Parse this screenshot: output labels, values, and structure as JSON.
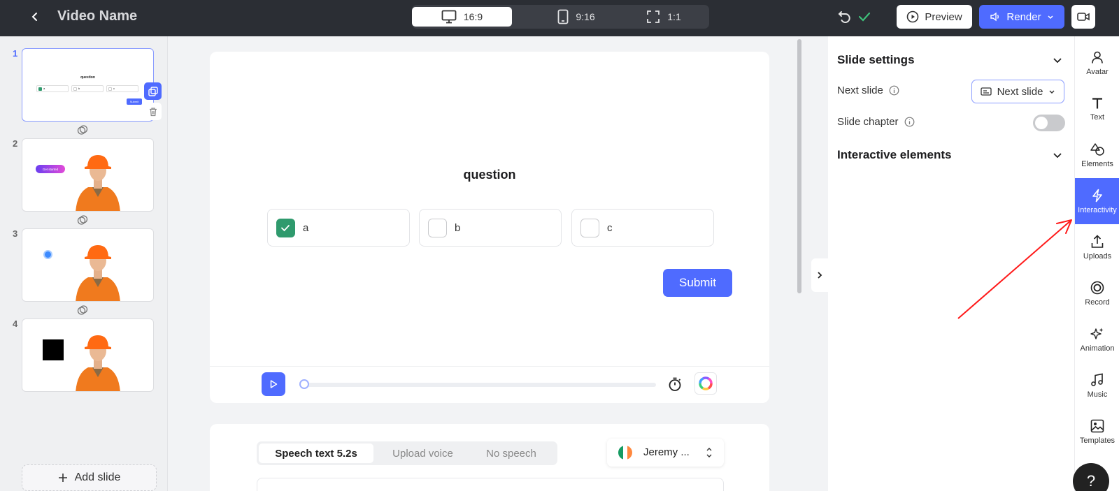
{
  "header": {
    "title": "Video Name",
    "ratios": [
      {
        "label": "16:9",
        "active": true
      },
      {
        "label": "9:16",
        "active": false
      },
      {
        "label": "1:1",
        "active": false
      }
    ],
    "preview_label": "Preview",
    "render_label": "Render"
  },
  "slides": {
    "items": [
      {
        "number": "1",
        "active": true,
        "thumb_title": "question",
        "thumb_submit": "Submit",
        "thumb_options": [
          "a",
          "b",
          "c"
        ]
      },
      {
        "number": "2",
        "active": false,
        "badge": "Get started"
      },
      {
        "number": "3",
        "active": false
      },
      {
        "number": "4",
        "active": false
      }
    ],
    "add_label": "Add slide"
  },
  "canvas": {
    "question": "question",
    "options": [
      {
        "label": "a",
        "checked": true
      },
      {
        "label": "b",
        "checked": false
      },
      {
        "label": "c",
        "checked": false
      }
    ],
    "submit_label": "Submit",
    "progress": 0
  },
  "speech": {
    "tabs": [
      {
        "label": "Speech text 5.2s",
        "active": true
      },
      {
        "label": "Upload voice",
        "active": false
      },
      {
        "label": "No speech",
        "active": false
      }
    ],
    "voice_name": "Jeremy ..."
  },
  "settings": {
    "slide_settings_title": "Slide settings",
    "next_slide_label": "Next slide",
    "next_slide_value": "Next slide",
    "slide_chapter_label": "Slide chapter",
    "slide_chapter_on": false,
    "interactive_title": "Interactive elements"
  },
  "toolbar": {
    "items": [
      {
        "label": "Avatar",
        "icon": "person-icon"
      },
      {
        "label": "Text",
        "icon": "text-icon"
      },
      {
        "label": "Elements",
        "icon": "shapes-icon"
      },
      {
        "label": "Interactivity",
        "icon": "lightning-icon",
        "active": true
      },
      {
        "label": "Uploads",
        "icon": "upload-icon"
      },
      {
        "label": "Record",
        "icon": "record-icon"
      },
      {
        "label": "Animation",
        "icon": "sparkle-icon"
      },
      {
        "label": "Music",
        "icon": "music-icon"
      },
      {
        "label": "Templates",
        "icon": "image-icon"
      }
    ],
    "help_label": "?"
  },
  "colors": {
    "accent": "#4f6bff",
    "check_green": "#2f9a6d",
    "topbar": "#2b2e34",
    "annotation": "#ff1a1a"
  }
}
